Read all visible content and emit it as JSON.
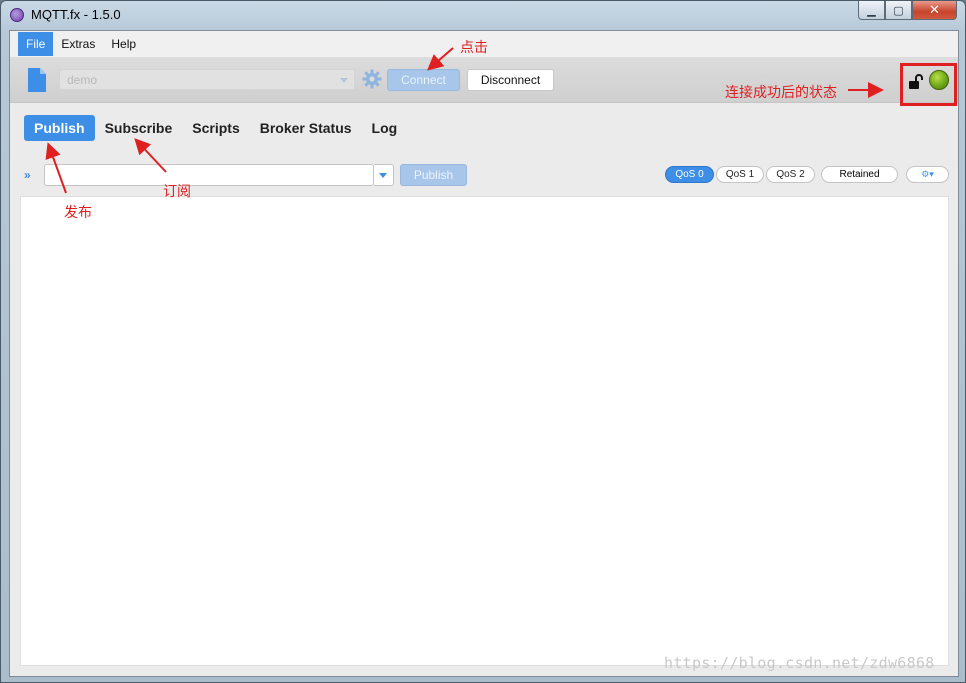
{
  "window": {
    "title": "MQTT.fx - 1.5.0"
  },
  "menu": {
    "items": [
      "File",
      "Extras",
      "Help"
    ]
  },
  "connection": {
    "profile": "demo",
    "connect_label": "Connect",
    "disconnect_label": "Disconnect"
  },
  "tabs": [
    "Publish",
    "Subscribe",
    "Scripts",
    "Broker Status",
    "Log"
  ],
  "publish": {
    "topic_value": "",
    "publish_label": "Publish",
    "qos": [
      "QoS 0",
      "QoS 1",
      "QoS 2"
    ],
    "retained_label": "Retained"
  },
  "annotations": {
    "click": "点击",
    "status": "连接成功后的状态",
    "publish": "发布",
    "subscribe": "订阅"
  },
  "watermark": "https://blog.csdn.net/zdw6868",
  "colors": {
    "accent": "#3c8ee6",
    "annotation": "#e02020",
    "status_led": "#6aa214"
  }
}
